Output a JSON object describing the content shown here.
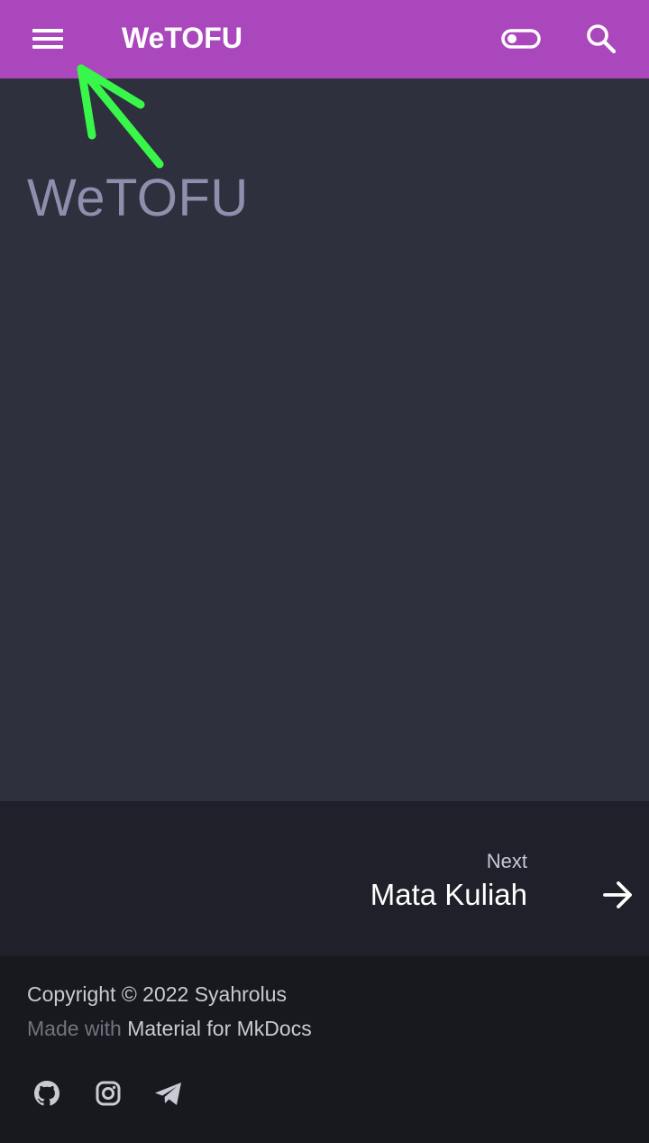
{
  "header": {
    "title": "WeTOFU",
    "menu_icon": "hamburger-menu-icon",
    "toggle_icon": "toggle-switch-icon",
    "search_icon": "search-icon",
    "background_color": "#ab47bd"
  },
  "annotation": {
    "icon": "arrow-annotation-icon",
    "color": "#39f74a"
  },
  "main": {
    "heading": "WeTOFU",
    "background_color": "#2e303e"
  },
  "footer_nav": {
    "next_label": "Next",
    "next_title": "Mata Kuliah",
    "arrow_icon": "arrow-right-icon"
  },
  "footer": {
    "copyright": "Copyright © 2022 Syahrolus",
    "made_with_prefix": "Made with",
    "made_with_link": "Material for MkDocs",
    "social_icons": [
      "github-icon",
      "instagram-icon",
      "telegram-icon"
    ]
  }
}
